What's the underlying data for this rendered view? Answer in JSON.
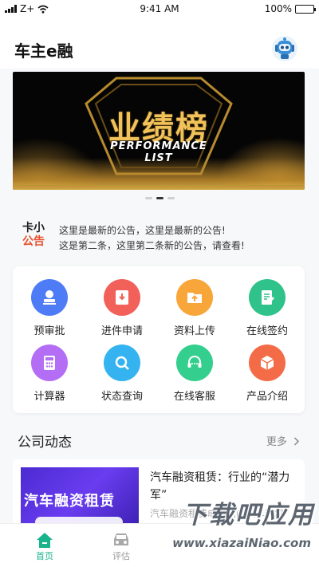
{
  "status_bar": {
    "carrier": "Z+",
    "time": "9:41 AM",
    "battery": "100%"
  },
  "header": {
    "title": "车主e融",
    "avatar_icon": "robot-icon"
  },
  "banner": {
    "title": "业绩榜",
    "subtitle_line1": "PERFORMANCE",
    "subtitle_line2": "LIST",
    "slide_count": 3,
    "active_slide": 1
  },
  "notice": {
    "logo_top": "卡小",
    "logo_bottom": "公告",
    "lines": [
      "这里是最新的公告，这里是最新的公告!",
      "这是第二条，这里第二条新的公告，请查看!"
    ]
  },
  "services": [
    {
      "label": "预审批",
      "icon": "user-stamp-icon",
      "color": "#4e7cf6"
    },
    {
      "label": "进件申请",
      "icon": "inbox-download-icon",
      "color": "#f2605a"
    },
    {
      "label": "资料上传",
      "icon": "folder-upload-icon",
      "color": "#f8a53a"
    },
    {
      "label": "在线签约",
      "icon": "sign-document-icon",
      "color": "#2fc28a"
    },
    {
      "label": "计算器",
      "icon": "calculator-icon",
      "color": "#b46ef5"
    },
    {
      "label": "状态查询",
      "icon": "search-icon",
      "color": "#34b3f0"
    },
    {
      "label": "在线客服",
      "icon": "headset-icon",
      "color": "#34cf8e"
    },
    {
      "label": "产品介绍",
      "icon": "cube-icon",
      "color": "#f46c47"
    }
  ],
  "news_section": {
    "title": "公司动态",
    "more_label": "更多"
  },
  "news": [
    {
      "title": "汽车融资租赁：行业的“潜力军”",
      "desc": "汽车融资租赁成为国内汽车新增",
      "thumb_text": "汽车融资租赁"
    }
  ],
  "tabs": [
    {
      "label": "首页",
      "icon": "home-icon",
      "active": true
    },
    {
      "label": "评估",
      "icon": "car-icon",
      "active": false
    }
  ],
  "watermark": {
    "main": "下载吧应用",
    "sub": "www.xiazaiNiao.com"
  }
}
